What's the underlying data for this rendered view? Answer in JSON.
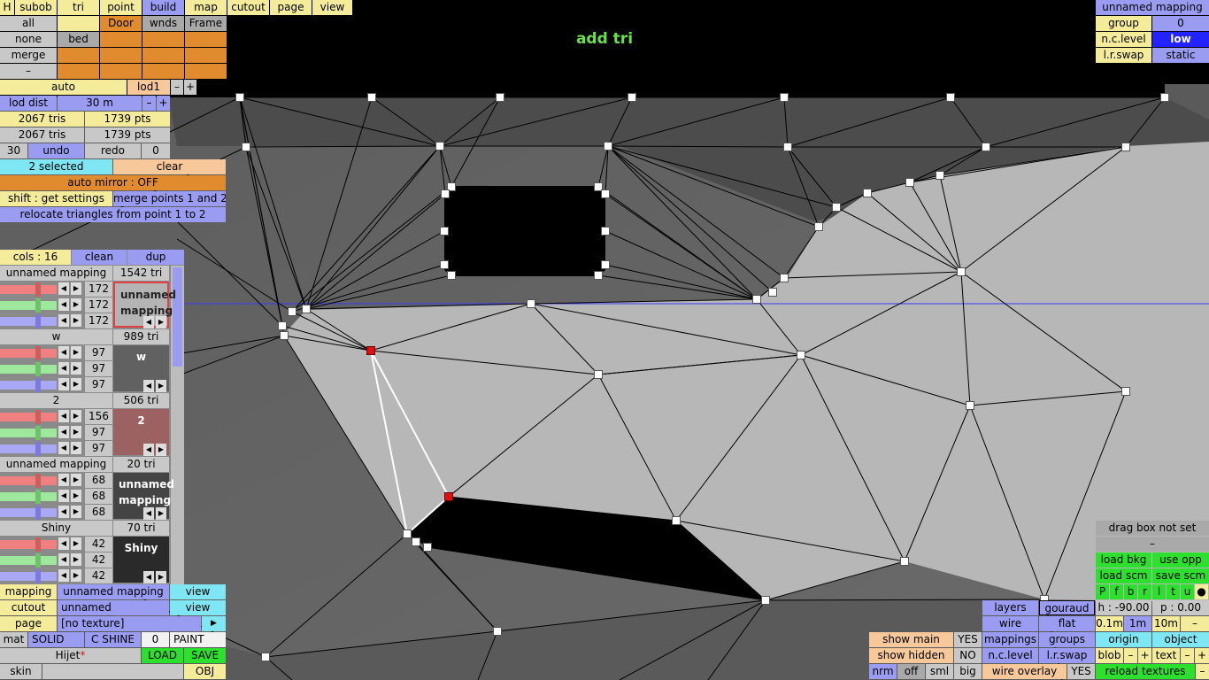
{
  "title": "add tri",
  "colors": {
    "accent_green": "#6be04a",
    "selected_vertex": "#e01010",
    "guide_line": "#3a3aff"
  },
  "top_menu": [
    "H",
    "subob",
    "tri",
    "point",
    "build",
    "map",
    "cutout",
    "page",
    "view"
  ],
  "select_row1": [
    "all",
    "",
    "Door",
    "wnds",
    "Frame"
  ],
  "select_row2": [
    "none",
    "bed"
  ],
  "select_row3": [
    "merge"
  ],
  "select_row4": [
    "–"
  ],
  "lod": {
    "auto": "auto",
    "lod1": "lod1",
    "minus": "–",
    "plus": "+",
    "dist_label": "lod dist",
    "dist_value": "30 m",
    "dist_minus": "–",
    "dist_plus": "+"
  },
  "stats": {
    "tris1": "2067 tris",
    "pts1": "1739 pts",
    "tris2": "2067 tris",
    "pts2": "1739 pts"
  },
  "undo": {
    "count": "30",
    "undo": "undo",
    "redo": "redo",
    "redo_count": "0"
  },
  "selection": {
    "selected": "2 selected",
    "clear": "clear",
    "auto_mirror": "auto mirror : OFF",
    "shift": "shift : get settings",
    "merge": "merge points 1 and 2",
    "relocate": "relocate triangles from point 1 to 2"
  },
  "cols": {
    "label": "cols : 16",
    "clean": "clean",
    "dup": "dup"
  },
  "materials": [
    {
      "name": "unnamed mapping",
      "tris": "1542 tri",
      "r": "172",
      "g": "172",
      "b": "172",
      "swatch": "unnamed mapping",
      "swatch_color": "#b4b4b4",
      "swatch_text": "#222"
    },
    {
      "name": "w",
      "tris": "989 tri",
      "r": "97",
      "g": "97",
      "b": "97",
      "swatch": "w",
      "swatch_color": "#616161",
      "swatch_text": "#fff"
    },
    {
      "name": "2",
      "tris": "506 tri",
      "r": "156",
      "g": "97",
      "b": "97",
      "swatch": "2",
      "swatch_color": "#9c6161",
      "swatch_text": "#fff"
    },
    {
      "name": "unnamed mapping",
      "tris": "20 tri",
      "r": "68",
      "g": "68",
      "b": "68",
      "swatch": "unnamed mapping",
      "swatch_color": "#444444",
      "swatch_text": "#fff"
    },
    {
      "name": "Shiny",
      "tris": "70 tri",
      "r": "42",
      "g": "42",
      "b": "42",
      "swatch": "Shiny",
      "swatch_color": "#2a2a2a",
      "swatch_text": "#fff"
    }
  ],
  "props": {
    "mapping_label": "mapping",
    "mapping_value": "unnamed mapping",
    "mapping_view": "view",
    "cutout_label": "cutout",
    "cutout_value": "unnamed",
    "cutout_view": "view",
    "page_label": "page",
    "page_value": "[no texture]",
    "page_arrow": "▶",
    "mat": "mat",
    "solid": "SOLID",
    "cshine": "C SHINE",
    "zero": "0",
    "paint": "PAINT",
    "name": "Hijet",
    "asterisk": "*",
    "load": "LOAD",
    "save": "SAVE",
    "skin": "skin",
    "obj": "OBJ"
  },
  "mapping_panel": {
    "title": "unnamed mapping",
    "group_label": "group",
    "group_value": "0",
    "nc_label": "n.c.level",
    "nc_value": "low",
    "lr_label": "l.r.swap",
    "lr_value": "static"
  },
  "right_panel": {
    "drag": "drag box not set",
    "dash": "–",
    "load_bkg": "load bkg",
    "use_opp": "use opp",
    "load_scm": "load scm",
    "save_scm": "save scm",
    "flags": [
      "P",
      "f",
      "b",
      "r",
      "l",
      "t",
      "u",
      "●"
    ],
    "h": "h : -90.00",
    "p": "p : 0.00",
    "steps": [
      "0.1m",
      "1m",
      "10m",
      "–"
    ],
    "origin": "origin",
    "object": "object",
    "blob": "blob",
    "text": "text",
    "minus": "–",
    "plus": "+",
    "reload": "reload textures"
  },
  "render_panel": {
    "layers": "layers",
    "gouraud": "gouraud",
    "wire": "wire",
    "flat": "flat",
    "mappings": "mappings",
    "groups": "groups",
    "nc_level": "n.c.level",
    "lr_swap": "l.r.swap",
    "wire_overlay": "wire overlay",
    "wire_overlay_value": "YES"
  },
  "show_panel": {
    "show_main": "show main",
    "show_main_value": "YES",
    "show_hidden": "show hidden",
    "show_hidden_value": "NO",
    "sizes": [
      "nrm",
      "off",
      "sml",
      "big"
    ]
  }
}
